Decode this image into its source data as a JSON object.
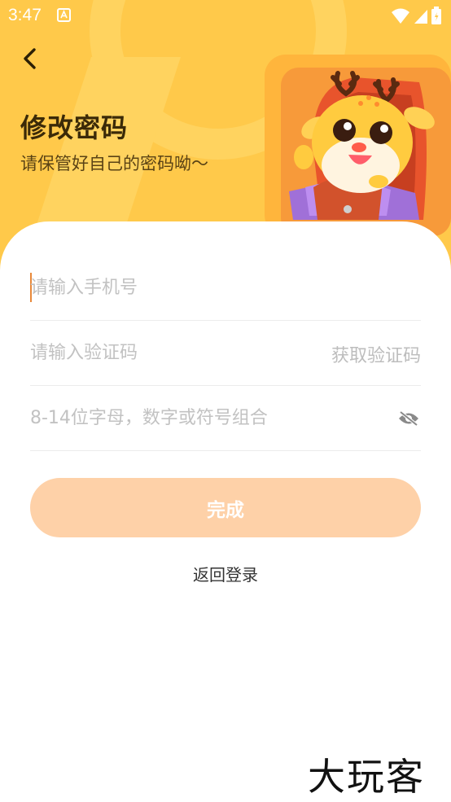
{
  "status_bar": {
    "time": "3:47"
  },
  "header": {
    "title": "修改密码",
    "subtitle": "请保管好自己的密码呦～"
  },
  "form": {
    "phone_placeholder": "请输入手机号",
    "code_placeholder": "请输入验证码",
    "get_code_label": "获取验证码",
    "password_placeholder": "8-14位字母，数字或符号组合"
  },
  "actions": {
    "done_label": "完成",
    "back_to_login_label": "返回登录"
  },
  "watermark": {
    "text": "大玩客"
  },
  "colors": {
    "hero_bg": "#ffc94a",
    "button_bg": "#fed1a8",
    "caret": "#e8893a",
    "title": "#3b2a08"
  },
  "icons": [
    "back-arrow-icon",
    "eye-off-icon",
    "wifi-icon",
    "signal-icon",
    "battery-icon",
    "app-notification-icon"
  ]
}
